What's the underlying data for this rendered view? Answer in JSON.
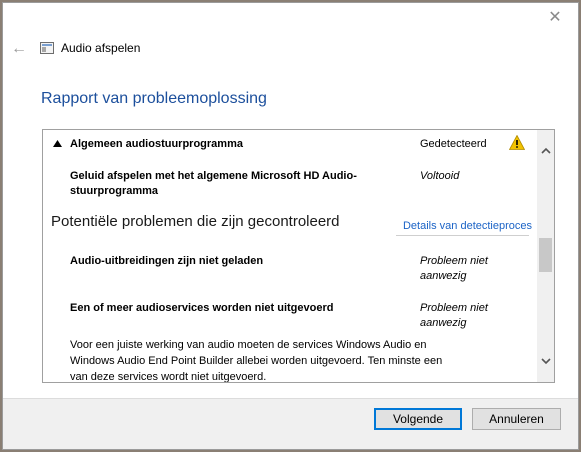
{
  "window": {
    "app_title": "Audio afspelen",
    "report_title": "Rapport van probleemoplossing"
  },
  "icons": {
    "close": "close-icon",
    "back": "back-arrow-icon",
    "app": "audio-app-icon",
    "collapse": "collapse-triangle-icon",
    "warning": "warning-icon"
  },
  "panel": {
    "group": {
      "label": "Algemeen audiostuurprogramma",
      "status": "Gedetecteerd"
    },
    "item1": {
      "label_line1": "Geluid afspelen met het algemene Microsoft HD Audio-",
      "label_line2": "stuurprogramma",
      "status": "Voltooid"
    },
    "section": {
      "title": "Potentiële problemen die zijn gecontroleerd",
      "link": "Details van detectieproces"
    },
    "item2": {
      "label": "Audio-uitbreidingen zijn niet geladen",
      "status_line1": "Probleem niet",
      "status_line2": "aanwezig"
    },
    "item3": {
      "label": "Een of meer audioservices worden niet uitgevoerd",
      "status_line1": "Probleem niet",
      "status_line2": "aanwezig"
    },
    "description": {
      "line1": "Voor een juiste werking van audio moeten de services Windows Audio en",
      "line2": "Windows Audio End Point Builder allebei worden uitgevoerd. Ten minste een",
      "line3": "van deze services wordt niet uitgevoerd."
    }
  },
  "footer": {
    "next_label": "Volgende",
    "cancel_label": "Annuleren"
  },
  "colors": {
    "accent": "#1c4f9c",
    "link": "#1b63c6",
    "warning": "#f2c200",
    "primary_border": "#0078d7"
  }
}
